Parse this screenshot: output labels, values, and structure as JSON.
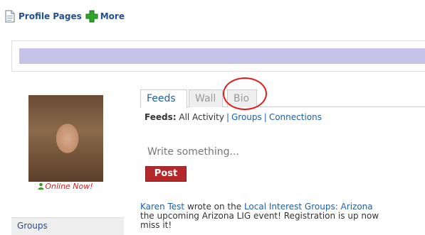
{
  "top": {
    "profile_pages": "Profile Pages",
    "more": "More"
  },
  "profile": {
    "online_status": "Online Now!"
  },
  "sidebar": {
    "groups_label": "Groups"
  },
  "tabs": [
    {
      "label": "Feeds",
      "active": true
    },
    {
      "label": "Wall",
      "active": false
    },
    {
      "label": "Bio",
      "active": false
    }
  ],
  "feeds_filter": {
    "prefix": "Feeds:",
    "all_activity": "All Activity",
    "groups": "Groups",
    "connections": "Connections"
  },
  "composer": {
    "placeholder": "Write something...",
    "post_label": "Post"
  },
  "activity": {
    "author": "Karen Test",
    "verb": " wrote on the ",
    "target": "Local Interest Groups: Arizona",
    "line2": "the upcoming Arizona LIG event! Registration is up now",
    "line3": "miss it!"
  },
  "colors": {
    "link": "#1f5fa8",
    "accent_red": "#b5282b",
    "highlight_circle": "#e21b1b",
    "purple_bar": "#c7c2e8",
    "online_green": "#3a9a2a"
  }
}
